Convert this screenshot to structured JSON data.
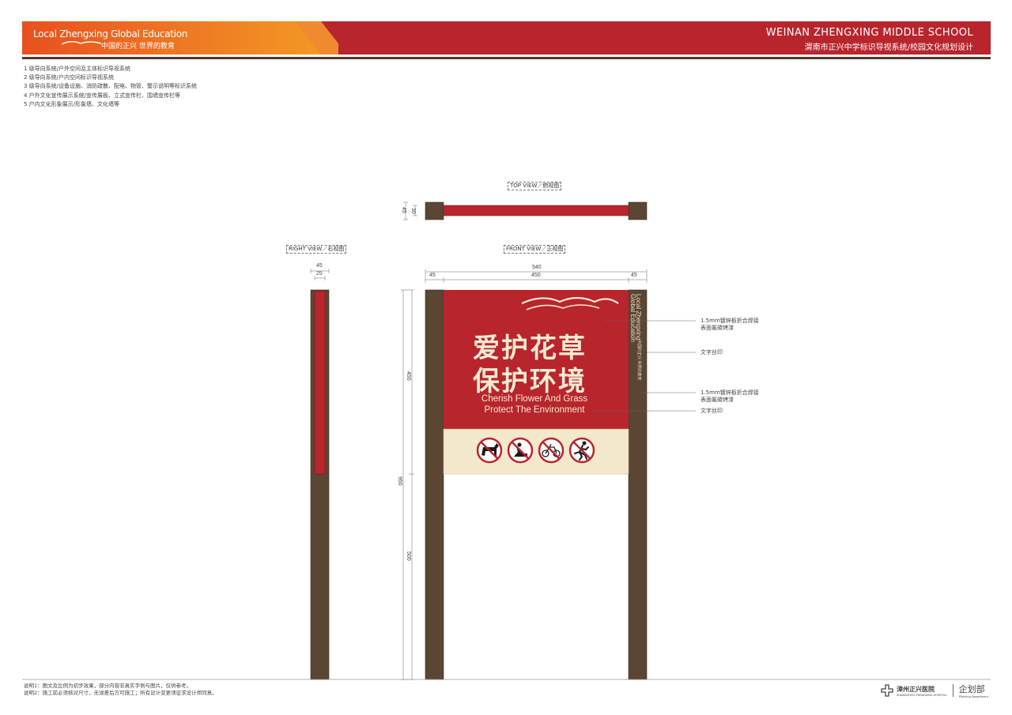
{
  "header": {
    "brand": "Local Zhengxing Global Education",
    "brand_sub": "中国的正兴  世界的教育",
    "school": "WEINAN ZHENGXING MIDDLE SCHOOL",
    "school_sub": "渭南市正兴中学标识导视系统/校园文化规划设计",
    "colors": {
      "orange": "#ee7a23",
      "red": "#b8252d",
      "blue": "#2a8fb8"
    }
  },
  "legend": [
    "1 级导向系统/户外空间及主体标识导视系统",
    "2 级导向系统/户内空间标识导视系统",
    "3 级导向系统/设备设施、消防疏散、配电、物管、警示说明等标识系统",
    "4 户外文化宣传展示系统/宣传展板、立式宣传栏、围墙宣传栏等",
    "5 户内文化形象展示/形象墙、文化墙等"
  ],
  "views": {
    "top": "TOP VIEW／俯视图",
    "right": "RIGHT VIEW／右视图",
    "front": "FRONT VIEW／正视图"
  },
  "dimensions": {
    "top_total": "45",
    "top_inner": "30",
    "side_total": "45",
    "side_inner": "25",
    "front_total": "540",
    "front_left": "45",
    "front_mid": "450",
    "front_right": "45",
    "height_panel": "450",
    "height_total": "950",
    "height_bottom": "500"
  },
  "sign": {
    "title_line1": "爱护花草",
    "title_line2": "保护环境",
    "en_line1": "Cherish Flower And Grass",
    "en_line2": "Protect The Environment",
    "post_brand": "Local Zhengxing",
    "post_brand2": "Global Education",
    "post_cn": "中国的正兴  世界的教育",
    "icons": [
      "no-dogs-icon",
      "no-trampling-icon",
      "no-cycling-icon",
      "no-running-icon"
    ],
    "colors": {
      "panel": "#b8252d",
      "strip": "#f4e8cc",
      "post": "#5b4634",
      "text": "#f5ead2"
    }
  },
  "annotations": [
    {
      "line1": "1.5mm镀锌板折合焊接",
      "line2": "表面氟碳烤漆"
    },
    {
      "line1": "文字丝印",
      "line2": ""
    },
    {
      "line1": "1.5mm镀锌板折合焊接",
      "line2": "表面氟碳烤漆"
    },
    {
      "line1": "文字丝印",
      "line2": ""
    }
  ],
  "footer": {
    "note1": "说明1：图文及比例为初步效果，部分内容非真实字例与图片，仅供参考。",
    "note2": "说明2：施工前必须核对尺寸，无误差后方可施工；所有设计变更须征求设计师同意。",
    "hospital": "漳州正兴医院",
    "hospital_en": "ZHANGZHOU ZHENGXING HOSPITAL",
    "department": "企划部",
    "department_en": "Planning Department"
  }
}
